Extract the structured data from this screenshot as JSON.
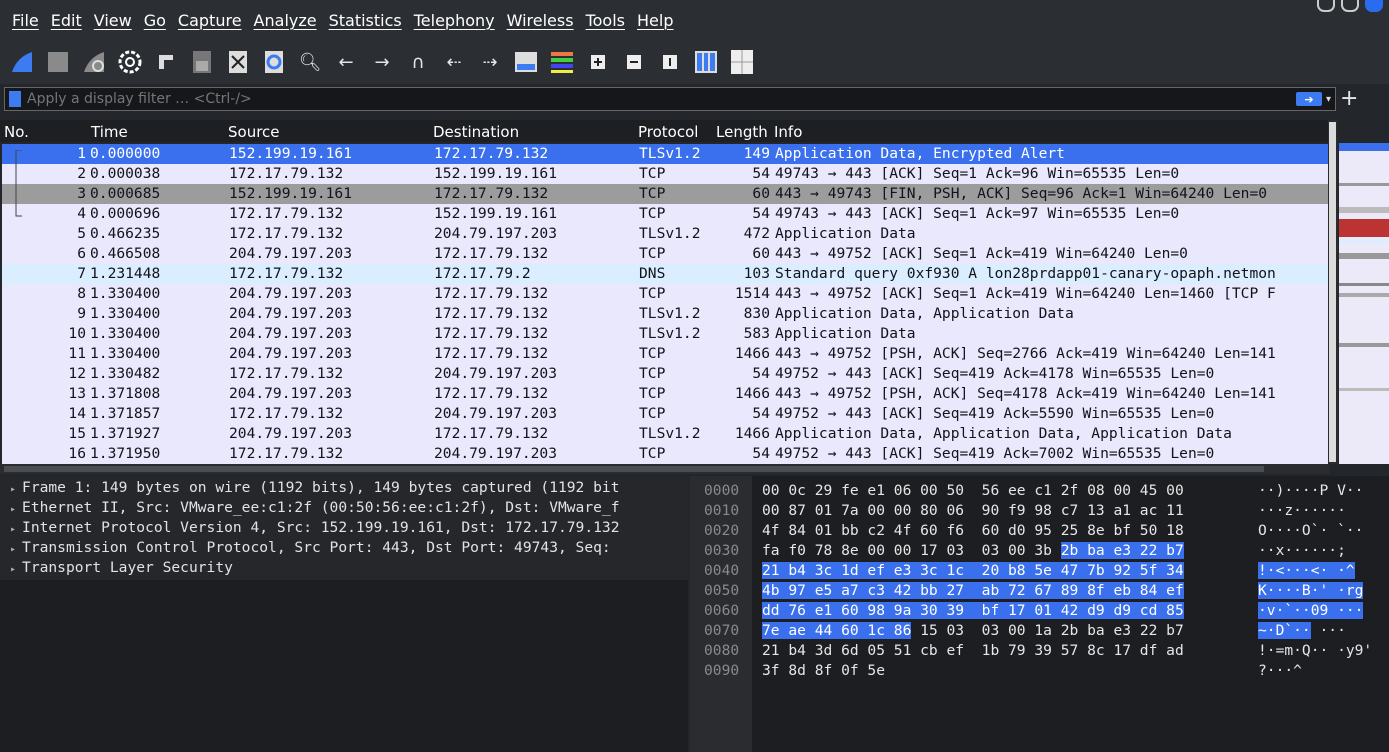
{
  "menu": [
    "File",
    "Edit",
    "View",
    "Go",
    "Capture",
    "Analyze",
    "Statistics",
    "Telephony",
    "Wireless",
    "Tools",
    "Help"
  ],
  "toolbar_icons": [
    "shark-fin-start-icon",
    "stop-icon",
    "restart-icon",
    "options-gear-icon",
    "open-file-icon",
    "save-file-icon",
    "close-file-icon",
    "reload-icon",
    "find-icon",
    "back-icon",
    "forward-icon",
    "go-to-packet-icon",
    "first-packet-icon",
    "last-packet-icon",
    "autoscroll-icon",
    "colorize-icon",
    "zoom-in-icon",
    "zoom-out-icon",
    "normal-size-icon",
    "resize-columns-icon",
    "layout-icon"
  ],
  "filter": {
    "placeholder": "Apply a display filter … <Ctrl-/>"
  },
  "columns": {
    "no": "No.",
    "time": "Time",
    "source": "Source",
    "destination": "Destination",
    "protocol": "Protocol",
    "length": "Length",
    "info": "Info"
  },
  "packets": [
    {
      "no": "1",
      "time": "0.000000",
      "src": "152.199.19.161",
      "dst": "172.17.79.132",
      "proto": "TLSv1.2",
      "len": "149",
      "info": "Application Data, Encrypted Alert",
      "style": "sel"
    },
    {
      "no": "2",
      "time": "0.000038",
      "src": "172.17.79.132",
      "dst": "152.199.19.161",
      "proto": "TCP",
      "len": "54",
      "info": "49743 → 443 [ACK] Seq=1 Ack=96 Win=65535 Len=0",
      "style": ""
    },
    {
      "no": "3",
      "time": "0.000685",
      "src": "152.199.19.161",
      "dst": "172.17.79.132",
      "proto": "TCP",
      "len": "60",
      "info": "443 → 49743 [FIN, PSH, ACK] Seq=96 Ack=1 Win=64240 Len=0",
      "style": "gray"
    },
    {
      "no": "4",
      "time": "0.000696",
      "src": "172.17.79.132",
      "dst": "152.199.19.161",
      "proto": "TCP",
      "len": "54",
      "info": "49743 → 443 [ACK] Seq=1 Ack=97 Win=65535 Len=0",
      "style": ""
    },
    {
      "no": "5",
      "time": "0.466235",
      "src": "172.17.79.132",
      "dst": "204.79.197.203",
      "proto": "TLSv1.2",
      "len": "472",
      "info": "Application Data",
      "style": ""
    },
    {
      "no": "6",
      "time": "0.466508",
      "src": "204.79.197.203",
      "dst": "172.17.79.132",
      "proto": "TCP",
      "len": "60",
      "info": "443 → 49752 [ACK] Seq=1 Ack=419 Win=64240 Len=0",
      "style": ""
    },
    {
      "no": "7",
      "time": "1.231448",
      "src": "172.17.79.132",
      "dst": "172.17.79.2",
      "proto": "DNS",
      "len": "103",
      "info": "Standard query 0xf930 A lon28prdapp01-canary-opaph.netmon",
      "style": "dns"
    },
    {
      "no": "8",
      "time": "1.330400",
      "src": "204.79.197.203",
      "dst": "172.17.79.132",
      "proto": "TCP",
      "len": "1514",
      "info": "443 → 49752 [ACK] Seq=1 Ack=419 Win=64240 Len=1460 [TCP F",
      "style": ""
    },
    {
      "no": "9",
      "time": "1.330400",
      "src": "204.79.197.203",
      "dst": "172.17.79.132",
      "proto": "TLSv1.2",
      "len": "830",
      "info": "Application Data, Application Data",
      "style": ""
    },
    {
      "no": "10",
      "time": "1.330400",
      "src": "204.79.197.203",
      "dst": "172.17.79.132",
      "proto": "TLSv1.2",
      "len": "583",
      "info": "Application Data",
      "style": ""
    },
    {
      "no": "11",
      "time": "1.330400",
      "src": "204.79.197.203",
      "dst": "172.17.79.132",
      "proto": "TCP",
      "len": "1466",
      "info": "443 → 49752 [PSH, ACK] Seq=2766 Ack=419 Win=64240 Len=141",
      "style": ""
    },
    {
      "no": "12",
      "time": "1.330482",
      "src": "172.17.79.132",
      "dst": "204.79.197.203",
      "proto": "TCP",
      "len": "54",
      "info": "49752 → 443 [ACK] Seq=419 Ack=4178 Win=65535 Len=0",
      "style": ""
    },
    {
      "no": "13",
      "time": "1.371808",
      "src": "204.79.197.203",
      "dst": "172.17.79.132",
      "proto": "TCP",
      "len": "1466",
      "info": "443 → 49752 [PSH, ACK] Seq=4178 Ack=419 Win=64240 Len=141",
      "style": ""
    },
    {
      "no": "14",
      "time": "1.371857",
      "src": "172.17.79.132",
      "dst": "204.79.197.203",
      "proto": "TCP",
      "len": "54",
      "info": "49752 → 443 [ACK] Seq=419 Ack=5590 Win=65535 Len=0",
      "style": ""
    },
    {
      "no": "15",
      "time": "1.371927",
      "src": "204.79.197.203",
      "dst": "172.17.79.132",
      "proto": "TLSv1.2",
      "len": "1466",
      "info": "Application Data, Application Data, Application Data",
      "style": ""
    },
    {
      "no": "16",
      "time": "1.371950",
      "src": "172.17.79.132",
      "dst": "204.79.197.203",
      "proto": "TCP",
      "len": "54",
      "info": "49752 → 443 [ACK] Seq=419 Ack=7002 Win=65535 Len=0",
      "style": ""
    }
  ],
  "details": [
    "Frame 1: 149 bytes on wire (1192 bits), 149 bytes captured (1192 bit",
    "Ethernet II, Src: VMware_ee:c1:2f (00:50:56:ee:c1:2f), Dst: VMware_f",
    "Internet Protocol Version 4, Src: 152.199.19.161, Dst: 172.17.79.132",
    "Transmission Control Protocol, Src Port: 443, Dst Port: 49743, Seq:",
    "Transport Layer Security"
  ],
  "bytes": [
    {
      "off": "0000",
      "hex_plain": "00 0c 29 fe e1 06 00 50  56 ee c1 2f 08 00 45 00",
      "hex_hl": "",
      "hex_after": "",
      "ascii_plain": "··)····P V··",
      "ascii_hl": "",
      "ascii_after": ""
    },
    {
      "off": "0010",
      "hex_plain": "00 87 01 7a 00 00 80 06  90 f9 98 c7 13 a1 ac 11",
      "hex_hl": "",
      "hex_after": "",
      "ascii_plain": "···z······",
      "ascii_hl": "",
      "ascii_after": ""
    },
    {
      "off": "0020",
      "hex_plain": "4f 84 01 bb c2 4f 60 f6  60 d0 95 25 8e bf 50 18",
      "hex_hl": "",
      "hex_after": "",
      "ascii_plain": "O····O`· `··",
      "ascii_hl": "",
      "ascii_after": ""
    },
    {
      "off": "0030",
      "hex_plain": "fa f0 78 8e 00 00 17 03  03 00 3b ",
      "hex_hl": "2b ba e3 22 b7",
      "hex_after": "",
      "ascii_plain": "··x······;",
      "ascii_hl": "",
      "ascii_after": ""
    },
    {
      "off": "0040",
      "hex_plain": "",
      "hex_hl": "21 b4 3c 1d ef e3 3c 1c  20 b8 5e 47 7b 92 5f 34",
      "hex_after": "",
      "ascii_plain": "",
      "ascii_hl": "!·<···<· ·^",
      "ascii_after": ""
    },
    {
      "off": "0050",
      "hex_plain": "",
      "hex_hl": "4b 97 e5 a7 c3 42 bb 27  ab 72 67 89 8f eb 84 ef",
      "hex_after": "",
      "ascii_plain": "",
      "ascii_hl": "K····B·' ·rg",
      "ascii_after": ""
    },
    {
      "off": "0060",
      "hex_plain": "",
      "hex_hl": "dd 76 e1 60 98 9a 30 39  bf 17 01 42 d9 d9 cd 85",
      "hex_after": "",
      "ascii_plain": "",
      "ascii_hl": "·v·`··09 ···",
      "ascii_after": ""
    },
    {
      "off": "0070",
      "hex_plain": "",
      "hex_hl": "7e ae 44 60 1c 86",
      "hex_after": " 15 03  03 00 1a 2b ba e3 22 b7",
      "ascii_plain": "",
      "ascii_hl": "~·D`··",
      "ascii_after": " ···"
    },
    {
      "off": "0080",
      "hex_plain": "21 b4 3d 6d 05 51 cb ef  1b 79 39 57 8c 17 df ad",
      "hex_hl": "",
      "hex_after": "",
      "ascii_plain": "!·=m·Q·· ·y9'",
      "ascii_hl": "",
      "ascii_after": ""
    },
    {
      "off": "0090",
      "hex_plain": "3f 8d 8f 0f 5e",
      "hex_hl": "",
      "hex_after": "",
      "ascii_plain": "?···^",
      "ascii_hl": "",
      "ascii_after": ""
    }
  ]
}
